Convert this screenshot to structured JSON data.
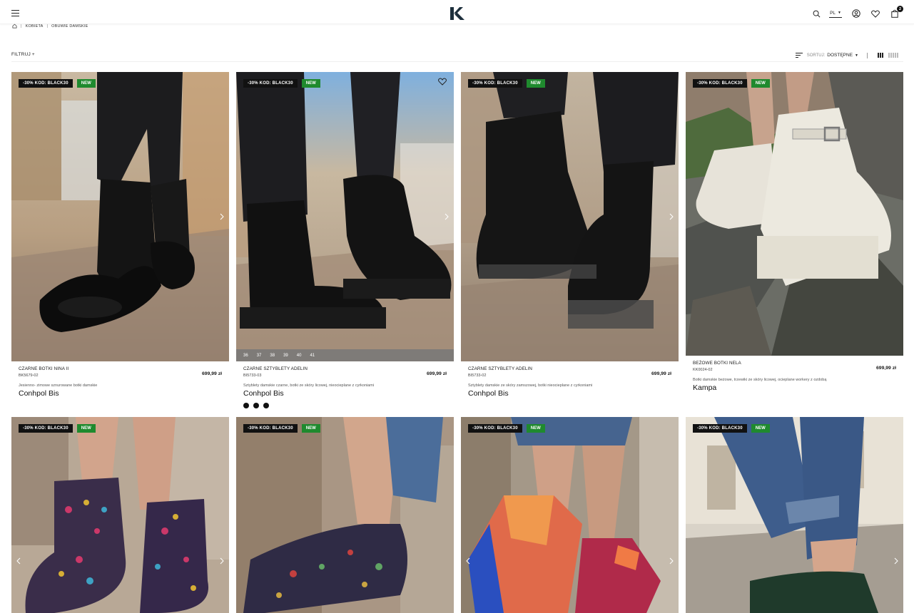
{
  "header": {
    "cart_count": "2",
    "language": "PL"
  },
  "breadcrumb": {
    "items": [
      "KOBIETA",
      "OBUWIE DAMSKIE"
    ]
  },
  "toolbar": {
    "filter_label": "FILTRUJ +",
    "sort_label": "SORTUJ:",
    "sort_value": "DOSTĘPNE"
  },
  "products": [
    {
      "promo": "-30% KOD: BLACK30",
      "badge": "NEW",
      "name": "CZARNE BOTKI NINA II",
      "sku": "BK5679-02",
      "price": "699,99 zł",
      "desc": "Jesienno- zimowe sznurowane botki damskie",
      "brand": "Conhpol Bis"
    },
    {
      "promo": "-30% KOD: BLACK30",
      "badge": "NEW",
      "name": "CZARNE SZTYBLETY ADELIN",
      "sku": "BI5733-03",
      "price": "699,99 zł",
      "desc": "Sztyblety damskie czarne, botki ze skóry licowej, nieocieplane z cyrkoniami",
      "brand": "Conhpol Bis",
      "sizes": [
        "36",
        "37",
        "38",
        "39",
        "40",
        "41"
      ]
    },
    {
      "promo": "-30% KOD: BLACK30",
      "badge": "NEW",
      "name": "CZARNE SZTYBLETY ADELIN",
      "sku": "BI5733-02",
      "price": "699,99 zł",
      "desc": "Sztyblety damskie ze skóry zamszowej, botki nieocieplane z cyrkoniami",
      "brand": "Conhpol Bis"
    },
    {
      "promo": "-30% KOD: BLACK30",
      "badge": "NEW",
      "name": "BEŻOWE BOTKI NELA",
      "sku": "KK0024-02",
      "price": "699,99 zł",
      "desc": "Botki damskie beżowe, trzewiki ze skóry licowej, ocieplane workery z ozdobą",
      "brand": "Kampa"
    },
    {
      "promo": "-30% KOD: BLACK30",
      "badge": "NEW"
    },
    {
      "promo": "-30% KOD: BLACK30",
      "badge": "NEW"
    },
    {
      "promo": "-30% KOD: BLACK30",
      "badge": "NEW"
    },
    {
      "promo": "-30% KOD: BLACK30",
      "badge": "NEW"
    }
  ],
  "colors": {
    "new_badge": "#1f8a2e",
    "promo_badge": "#111111"
  }
}
